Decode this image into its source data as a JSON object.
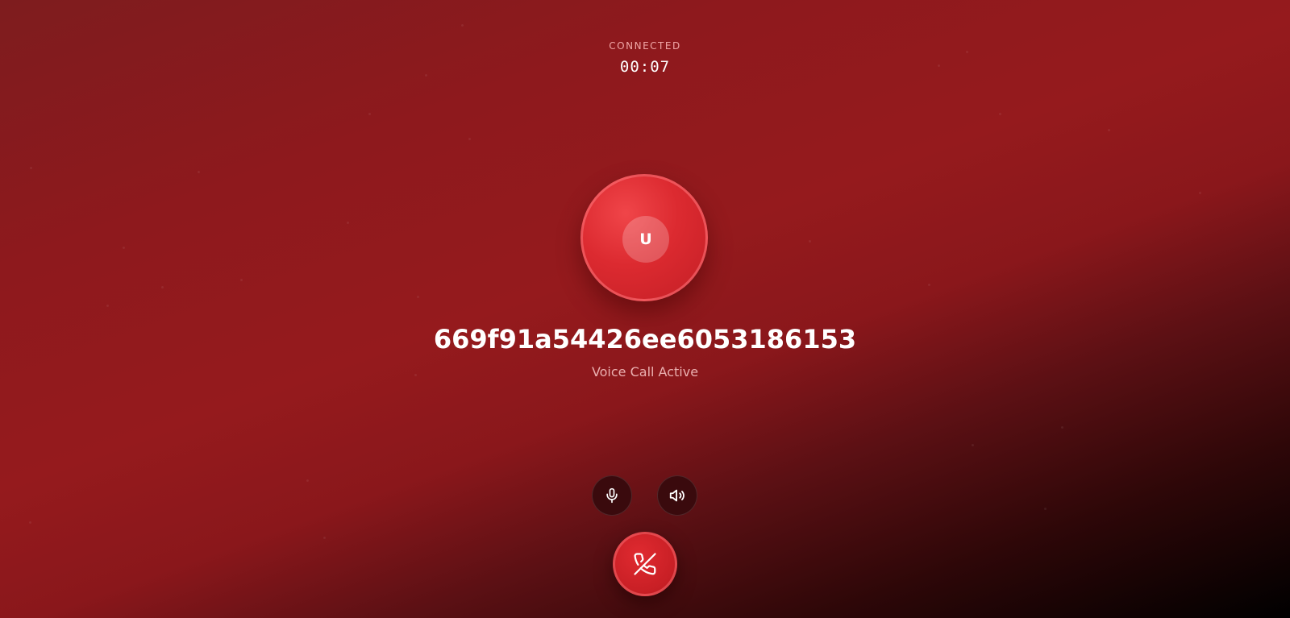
{
  "call": {
    "status": "CONNECTED",
    "timer": "00:07",
    "avatar_initial": "U",
    "caller_name": "669f91a54426ee6053186153",
    "call_type": "Voice Call Active"
  },
  "controls": {
    "mic_icon": "microphone-icon",
    "speaker_icon": "speaker-icon",
    "end_call_icon": "phone-hangup-icon"
  },
  "colors": {
    "background_top": "#8e191d",
    "background_bottom": "#000000",
    "avatar": "#dc2a30",
    "end_call": "#c81f25",
    "control_button": "#3a0a0d"
  }
}
